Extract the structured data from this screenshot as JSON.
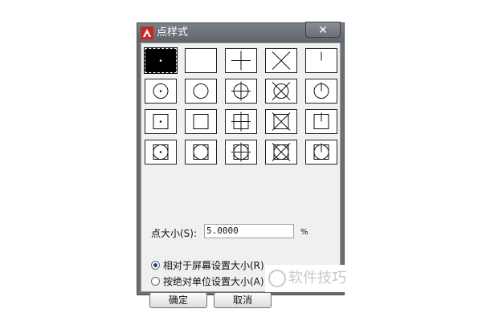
{
  "dialog": {
    "title": "点样式",
    "close_glyph": "✕",
    "point_styles": [
      {
        "symbol": "dot",
        "selected": true
      },
      {
        "symbol": "none",
        "selected": false
      },
      {
        "symbol": "plus",
        "selected": false
      },
      {
        "symbol": "x",
        "selected": false
      },
      {
        "symbol": "tick",
        "selected": false
      },
      {
        "symbol": "circle-dot",
        "selected": false
      },
      {
        "symbol": "circle",
        "selected": false
      },
      {
        "symbol": "circle-plus",
        "selected": false
      },
      {
        "symbol": "circle-x",
        "selected": false
      },
      {
        "symbol": "circle-tick",
        "selected": false
      },
      {
        "symbol": "square-dot",
        "selected": false
      },
      {
        "symbol": "square",
        "selected": false
      },
      {
        "symbol": "square-plus",
        "selected": false
      },
      {
        "symbol": "square-x",
        "selected": false
      },
      {
        "symbol": "square-tick",
        "selected": false
      },
      {
        "symbol": "circle-square-dot",
        "selected": false
      },
      {
        "symbol": "circle-square",
        "selected": false
      },
      {
        "symbol": "circle-square-plus",
        "selected": false
      },
      {
        "symbol": "circle-square-x",
        "selected": false
      },
      {
        "symbol": "circle-square-tick",
        "selected": false
      }
    ],
    "point_size_label": "点大小(S):",
    "point_size_value": "5.0000",
    "percent_label": "%",
    "radio_relative": {
      "label": "相对于屏幕设置大小(R)",
      "checked": true
    },
    "radio_absolute": {
      "label": "按绝对单位设置大小(A)",
      "checked": false
    },
    "ok_label": "确定",
    "cancel_label": "取消"
  },
  "watermark": {
    "text": "软件技巧"
  }
}
